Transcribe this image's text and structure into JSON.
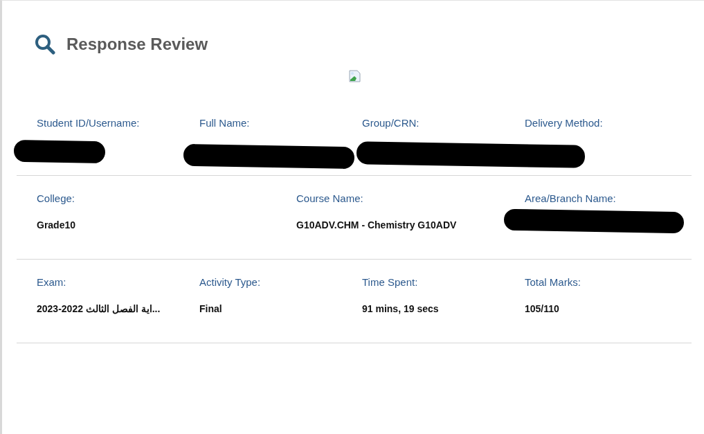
{
  "title": "Response Review",
  "sections": [
    {
      "fields": [
        {
          "label": "Student ID/Username:"
        },
        {
          "label": "Full Name:"
        },
        {
          "label": "Group/CRN:"
        },
        {
          "label": "Delivery Method:"
        }
      ]
    },
    {
      "fields": [
        {
          "label": "College:",
          "value": "Grade10"
        },
        {
          "label": "Course Name:",
          "value": "G10ADV.CHM - Chemistry G10ADV"
        },
        {
          "label": "Area/Branch Name:"
        }
      ]
    },
    {
      "fields": [
        {
          "label": "Exam:",
          "value": "اية الفصل الثالث 2022-2023..."
        },
        {
          "label": "Activity Type:",
          "value": "Final"
        },
        {
          "label": "Time Spent:",
          "value": "91 mins, 19 secs"
        },
        {
          "label": "Total Marks:",
          "value": "105/110"
        }
      ]
    }
  ]
}
